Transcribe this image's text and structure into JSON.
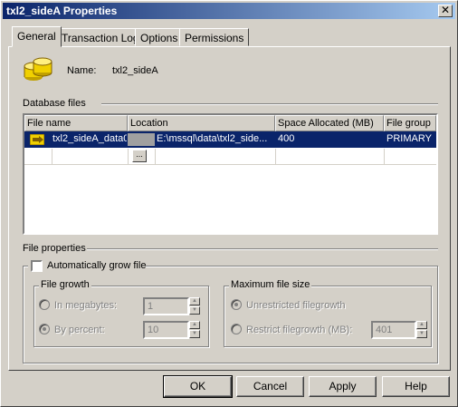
{
  "window": {
    "title": "txl2_sideA Properties",
    "close_glyph": "✕"
  },
  "tabs": [
    {
      "label": "General",
      "active": true
    },
    {
      "label": "Transaction Log",
      "active": false
    },
    {
      "label": "Options",
      "active": false
    },
    {
      "label": "Permissions",
      "active": false
    }
  ],
  "general": {
    "name_label": "Name:",
    "name_value": "txl2_sideA",
    "database_files_label": "Database files",
    "columns": [
      "File name",
      "Location",
      "Space Allocated (MB)",
      "File group"
    ],
    "rows": [
      {
        "file_name": "txl2_sideA_data0",
        "location": "E:\\mssql\\data\\txl2_side...",
        "space": "400",
        "file_group": "PRIMARY",
        "selected": true
      }
    ],
    "browse_button_label": "...",
    "file_properties_label": "File properties",
    "auto_grow_label": "Automatically grow file",
    "auto_grow_checked": false,
    "file_growth": {
      "label": "File growth",
      "megabytes_label": "In megabytes:",
      "megabytes_value": "1",
      "percent_label": "By percent:",
      "percent_value": "10",
      "selected": "percent"
    },
    "max_size": {
      "label": "Maximum file size",
      "unrestricted_label": "Unrestricted filegrowth",
      "restrict_label": "Restrict filegrowth (MB):",
      "restrict_value": "401",
      "selected": "unrestricted"
    }
  },
  "buttons": {
    "ok": "OK",
    "cancel": "Cancel",
    "apply": "Apply",
    "help": "Help"
  },
  "icons": {
    "database": "database-icon",
    "file_row": "data-file-icon",
    "close": "close-icon"
  },
  "colors": {
    "title_bar": "#0a246a",
    "selection": "#0a246a",
    "face": "#d4d0c8",
    "db_icon": "#f0d000"
  }
}
